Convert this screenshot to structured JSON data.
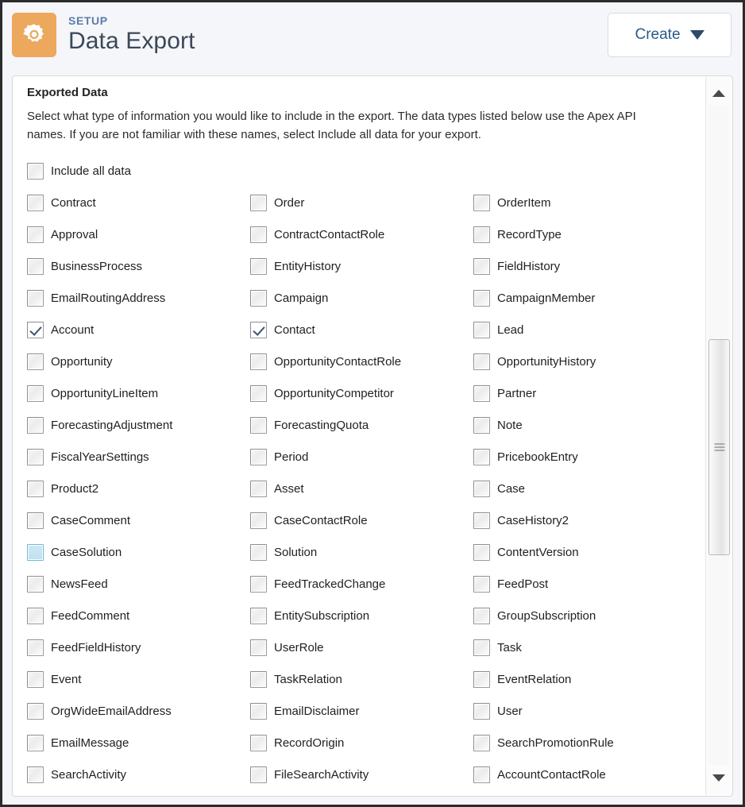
{
  "header": {
    "eyebrow": "SETUP",
    "title": "Data Export",
    "icon": "gear-icon",
    "icon_tile_color": "#eca85c",
    "create_button": {
      "label": "Create",
      "caret": "chevron-down-icon"
    }
  },
  "panel": {
    "section_title": "Exported Data",
    "description": "Select what type of information you would like to include in the export. The data types listed below use the Apex API names. If you are not familiar with these names, select Include all data for your export.",
    "columns": 3,
    "rows": [
      [
        {
          "label": "Include all data",
          "checked": false,
          "highlighted": false
        },
        null,
        null
      ],
      [
        {
          "label": "Contract",
          "checked": false,
          "highlighted": false
        },
        {
          "label": "Order",
          "checked": false,
          "highlighted": false
        },
        {
          "label": "OrderItem",
          "checked": false,
          "highlighted": false
        }
      ],
      [
        {
          "label": "Approval",
          "checked": false,
          "highlighted": false
        },
        {
          "label": "ContractContactRole",
          "checked": false,
          "highlighted": false
        },
        {
          "label": "RecordType",
          "checked": false,
          "highlighted": false
        }
      ],
      [
        {
          "label": "BusinessProcess",
          "checked": false,
          "highlighted": false
        },
        {
          "label": "EntityHistory",
          "checked": false,
          "highlighted": false
        },
        {
          "label": "FieldHistory",
          "checked": false,
          "highlighted": false
        }
      ],
      [
        {
          "label": "EmailRoutingAddress",
          "checked": false,
          "highlighted": false
        },
        {
          "label": "Campaign",
          "checked": false,
          "highlighted": false
        },
        {
          "label": "CampaignMember",
          "checked": false,
          "highlighted": false
        }
      ],
      [
        {
          "label": "Account",
          "checked": true,
          "highlighted": false
        },
        {
          "label": "Contact",
          "checked": true,
          "highlighted": false
        },
        {
          "label": "Lead",
          "checked": false,
          "highlighted": false
        }
      ],
      [
        {
          "label": "Opportunity",
          "checked": false,
          "highlighted": false
        },
        {
          "label": "OpportunityContactRole",
          "checked": false,
          "highlighted": false
        },
        {
          "label": "OpportunityHistory",
          "checked": false,
          "highlighted": false
        }
      ],
      [
        {
          "label": "OpportunityLineItem",
          "checked": false,
          "highlighted": false
        },
        {
          "label": "OpportunityCompetitor",
          "checked": false,
          "highlighted": false
        },
        {
          "label": "Partner",
          "checked": false,
          "highlighted": false
        }
      ],
      [
        {
          "label": "ForecastingAdjustment",
          "checked": false,
          "highlighted": false
        },
        {
          "label": "ForecastingQuota",
          "checked": false,
          "highlighted": false
        },
        {
          "label": "Note",
          "checked": false,
          "highlighted": false
        }
      ],
      [
        {
          "label": "FiscalYearSettings",
          "checked": false,
          "highlighted": false
        },
        {
          "label": "Period",
          "checked": false,
          "highlighted": false
        },
        {
          "label": "PricebookEntry",
          "checked": false,
          "highlighted": false
        }
      ],
      [
        {
          "label": "Product2",
          "checked": false,
          "highlighted": false
        },
        {
          "label": "Asset",
          "checked": false,
          "highlighted": false
        },
        {
          "label": "Case",
          "checked": false,
          "highlighted": false
        }
      ],
      [
        {
          "label": "CaseComment",
          "checked": false,
          "highlighted": false
        },
        {
          "label": "CaseContactRole",
          "checked": false,
          "highlighted": false
        },
        {
          "label": "CaseHistory2",
          "checked": false,
          "highlighted": false
        }
      ],
      [
        {
          "label": "CaseSolution",
          "checked": false,
          "highlighted": true
        },
        {
          "label": "Solution",
          "checked": false,
          "highlighted": false
        },
        {
          "label": "ContentVersion",
          "checked": false,
          "highlighted": false
        }
      ],
      [
        {
          "label": "NewsFeed",
          "checked": false,
          "highlighted": false
        },
        {
          "label": "FeedTrackedChange",
          "checked": false,
          "highlighted": false
        },
        {
          "label": "FeedPost",
          "checked": false,
          "highlighted": false
        }
      ],
      [
        {
          "label": "FeedComment",
          "checked": false,
          "highlighted": false
        },
        {
          "label": "EntitySubscription",
          "checked": false,
          "highlighted": false
        },
        {
          "label": "GroupSubscription",
          "checked": false,
          "highlighted": false
        }
      ],
      [
        {
          "label": "FeedFieldHistory",
          "checked": false,
          "highlighted": false
        },
        {
          "label": "UserRole",
          "checked": false,
          "highlighted": false
        },
        {
          "label": "Task",
          "checked": false,
          "highlighted": false
        }
      ],
      [
        {
          "label": "Event",
          "checked": false,
          "highlighted": false
        },
        {
          "label": "TaskRelation",
          "checked": false,
          "highlighted": false
        },
        {
          "label": "EventRelation",
          "checked": false,
          "highlighted": false
        }
      ],
      [
        {
          "label": "OrgWideEmailAddress",
          "checked": false,
          "highlighted": false
        },
        {
          "label": "EmailDisclaimer",
          "checked": false,
          "highlighted": false
        },
        {
          "label": "User",
          "checked": false,
          "highlighted": false
        }
      ],
      [
        {
          "label": "EmailMessage",
          "checked": false,
          "highlighted": false
        },
        {
          "label": "RecordOrigin",
          "checked": false,
          "highlighted": false
        },
        {
          "label": "SearchPromotionRule",
          "checked": false,
          "highlighted": false
        }
      ],
      [
        {
          "label": "SearchActivity",
          "checked": false,
          "highlighted": false
        },
        {
          "label": "FileSearchActivity",
          "checked": false,
          "highlighted": false
        },
        {
          "label": "AccountContactRole",
          "checked": false,
          "highlighted": false
        }
      ]
    ]
  },
  "scrollbar": {
    "up_arrow": "scroll-up-arrow-icon",
    "down_arrow": "scroll-down-arrow-icon",
    "thumb": "scrollbar-thumb"
  }
}
